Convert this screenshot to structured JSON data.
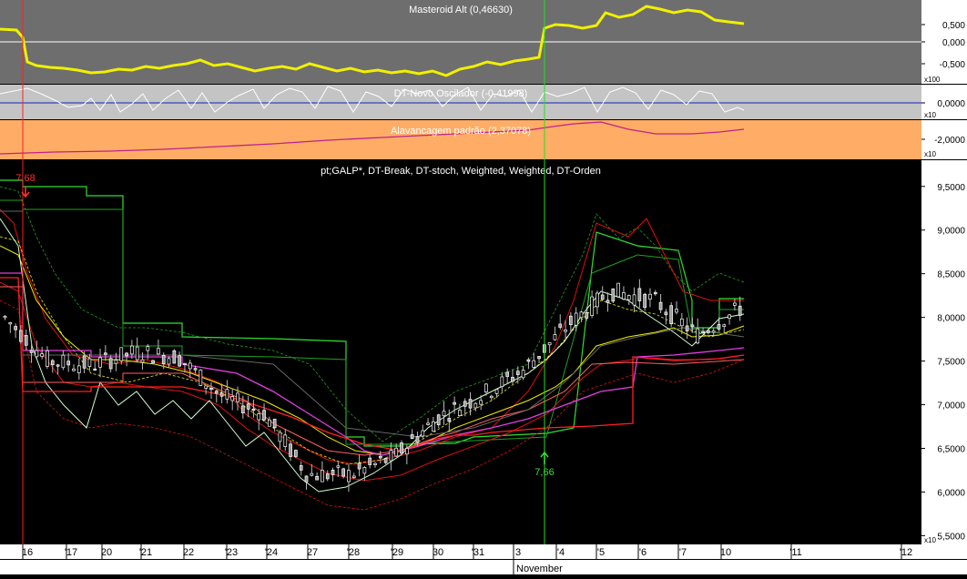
{
  "colors": {
    "masteroid_bg": "#6e6e6e",
    "oscillator_bg": "#c4c4c4",
    "leverage_bg": "#ffad66",
    "main_bg": "#000000",
    "axis_bg": "#ffffff",
    "yellow": "#f0f000",
    "white": "#ffffff",
    "blue": "#1020c0",
    "magenta": "#c0208a",
    "red": "#e01010",
    "green": "#20d020"
  },
  "panels": {
    "masteroid": {
      "title": "Masteroid Alt (0,46630)",
      "ticks": [
        "0,500",
        "0,000",
        "-0,500"
      ],
      "scale": "x100"
    },
    "oscillator": {
      "title": "DT-Novo Oscilador (-0,41998)",
      "ticks": [
        "0,0000"
      ],
      "scale": "x10"
    },
    "leverage": {
      "title": "Alavancagem padrão (2,37078)",
      "ticks": [
        "-2,0000"
      ],
      "scale": "x10"
    },
    "main": {
      "title": "pt;GALP*, DT-Break, DT-stoch, Weighted, Weighted, DT-Orden",
      "scale": "x10"
    }
  },
  "signals": {
    "sell": {
      "label": "7,68",
      "color": "#ff2020"
    },
    "buy": {
      "label": "7,66",
      "color": "#20e020"
    }
  },
  "xaxis": {
    "month_label": "November",
    "day_labels": [
      "16",
      "'17",
      "20",
      "'21",
      "22",
      "'23",
      "'24",
      "27",
      "'28",
      "'29",
      "30",
      "'31",
      "3",
      "'4",
      "'5",
      "'6",
      "'7",
      "10",
      "'11",
      "'12"
    ]
  },
  "chart_data": [
    {
      "type": "line",
      "title": "Masteroid Alt (0,46630)",
      "ylim": [
        -0.7,
        0.85
      ],
      "yticks": [
        0.5,
        0.0,
        -0.5
      ],
      "scale_note": "x100",
      "series": [
        {
          "name": "Masteroid Alt",
          "color": "#f0f000",
          "x": [
            0,
            0.5,
            1,
            2,
            3,
            4,
            5,
            6,
            7,
            8,
            9,
            10,
            11,
            12,
            13,
            14,
            15,
            16,
            17,
            18,
            19,
            20,
            21,
            22,
            23,
            24,
            25,
            26,
            27,
            28,
            29,
            30,
            31,
            32,
            33,
            34,
            35,
            36,
            36.5,
            37,
            38,
            39,
            40,
            41,
            42,
            43,
            44,
            45,
            46,
            47,
            48,
            49,
            50
          ],
          "values": [
            0.15,
            0.1,
            -0.38,
            -0.45,
            -0.5,
            -0.55,
            -0.58,
            -0.52,
            -0.55,
            -0.5,
            -0.48,
            -0.45,
            -0.42,
            -0.38,
            -0.45,
            -0.5,
            -0.42,
            -0.48,
            -0.52,
            -0.55,
            -0.45,
            -0.5,
            -0.55,
            -0.6,
            -0.52,
            -0.55,
            -0.62,
            -0.55,
            -0.58,
            -0.5,
            -0.45,
            -0.4,
            -0.48,
            -0.35,
            -0.3,
            -0.3,
            -0.28,
            -0.25,
            0.2,
            0.25,
            0.3,
            0.28,
            0.25,
            0.3,
            0.6,
            0.65,
            0.75,
            0.7,
            0.72,
            0.65,
            0.6,
            0.48,
            0.42
          ]
        }
      ]
    },
    {
      "type": "line",
      "title": "DT-Novo Oscilador (-0,41998)",
      "ylim": [
        -1,
        1
      ],
      "yticks": [
        0.0
      ],
      "scale_note": "x10",
      "series": [
        {
          "name": "DT-Novo Oscilador",
          "color": "#ffffff",
          "x": [
            0,
            1,
            2,
            3,
            4,
            5,
            6,
            7,
            8,
            9,
            10,
            11,
            12,
            13,
            14,
            15,
            16,
            17,
            18,
            19,
            20,
            21,
            22,
            23,
            24,
            25,
            26,
            27,
            28,
            29,
            30,
            31,
            32,
            33,
            34,
            35,
            36,
            37,
            38,
            39,
            40,
            41,
            42,
            43,
            44,
            45,
            46,
            47,
            48,
            49,
            50
          ],
          "values": [
            0.6,
            0.7,
            0.75,
            0.5,
            0.2,
            -0.1,
            -0.3,
            0.1,
            -0.5,
            0.3,
            -0.6,
            -0.2,
            0.4,
            -0.5,
            0.1,
            0.5,
            -0.4,
            0.4,
            -0.6,
            -0.2,
            0.2,
            0.5,
            -0.3,
            0.3,
            0.6,
            0.4,
            -0.4,
            0.7,
            0.5,
            -0.5,
            0.4,
            0.2,
            -0.3,
            0.6,
            0.3,
            0.5,
            -0.2,
            0.3,
            0.7,
            -0.4,
            0.3,
            0.2,
            0.6,
            -0.6,
            0.5,
            0.8,
            0.3,
            -0.5,
            0.4,
            0.6,
            -0.42
          ]
        },
        {
          "name": "zero line",
          "color": "#1020c0",
          "x": [
            0,
            50
          ],
          "values": [
            0,
            0
          ]
        }
      ]
    },
    {
      "type": "line",
      "title": "Alavancagem padrão (2,37078)",
      "ylim": [
        -3,
        3
      ],
      "yticks": [
        -2.0
      ],
      "scale_note": "x10",
      "series": [
        {
          "name": "Alavancagem padrão",
          "color": "#c0208a",
          "x": [
            0,
            5,
            10,
            15,
            20,
            25,
            30,
            35,
            38,
            40,
            42,
            44,
            46,
            48,
            50
          ],
          "values": [
            -2.8,
            -2.5,
            -2.0,
            -1.5,
            -0.8,
            0.0,
            0.8,
            1.6,
            2.6,
            2.9,
            2.0,
            1.2,
            1.0,
            1.2,
            2.37
          ]
        }
      ]
    },
    {
      "type": "candlestick",
      "title": "pt;GALP*, DT-Break, DT-stoch, Weighted, Weighted, DT-Orden",
      "ylim": [
        5.4,
        9.8
      ],
      "yticks": [
        9.5,
        9.0,
        8.5,
        8.0,
        7.5,
        7.0,
        6.5,
        6.0,
        5.5
      ],
      "scale_note": "x10",
      "categories": [
        "16",
        "'17",
        "20",
        "'21",
        "22",
        "'23",
        "'24",
        "27",
        "'28",
        "'29",
        "30",
        "'31",
        "3",
        "'4",
        "'5",
        "'6",
        "'7",
        "10"
      ],
      "close": [
        8.0,
        7.5,
        7.45,
        7.6,
        7.55,
        7.1,
        6.9,
        6.2,
        6.2,
        6.4,
        6.85,
        7.1,
        7.4,
        7.9,
        8.3,
        8.2,
        7.8,
        8.1
      ],
      "markers": [
        {
          "label": "7,68",
          "type": "sell",
          "category": "16"
        },
        {
          "label": "7,66",
          "type": "buy",
          "category": "3"
        }
      ]
    }
  ]
}
